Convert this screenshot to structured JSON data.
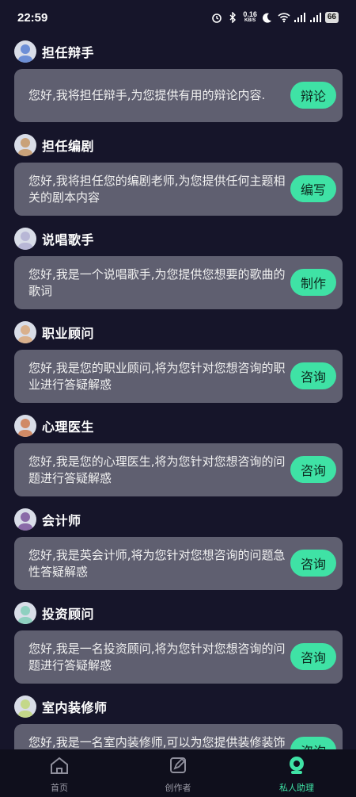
{
  "status_bar": {
    "time": "22:59",
    "network_speed": "0.16",
    "speed_unit": "KB/S",
    "battery": "66"
  },
  "assistants": [
    {
      "name": "担任辩手",
      "description": "您好,我将担任辩手,为您提供有用的辩论内容.",
      "action": "辩论",
      "avatar_color": "#6d8fd6"
    },
    {
      "name": "担任编剧",
      "description": "您好,我将担任您的编剧老师,为您提供任何主题相关的剧本内容",
      "action": "编写",
      "avatar_color": "#c9a27a"
    },
    {
      "name": "说唱歌手",
      "description": "您好,我是一个说唱歌手,为您提供您想要的歌曲的歌词",
      "action": "制作",
      "avatar_color": "#b8b7d6"
    },
    {
      "name": "职业顾问",
      "description": "您好,我是您的职业顾问,将为您针对您想咨询的职业进行答疑解惑",
      "action": "咨询",
      "avatar_color": "#d9b08c"
    },
    {
      "name": "心理医生",
      "description": "您好,我是您的心理医生,将为您针对您想咨询的问题进行答疑解惑",
      "action": "咨询",
      "avatar_color": "#d08a66"
    },
    {
      "name": "会计师",
      "description": "您好,我是英会计师,将为您针对您想咨询的问题急性答疑解惑",
      "action": "咨询",
      "avatar_color": "#8a6aa8"
    },
    {
      "name": "投资顾问",
      "description": "您好,我是一名投资顾问,将为您针对您想咨询的问题进行答疑解惑",
      "action": "咨询",
      "avatar_color": "#8fd0c0"
    },
    {
      "name": "室内装修师",
      "description": "您好,我是一名室内装修师,可以为您提供装修装饰相关的建议.",
      "action": "咨询",
      "avatar_color": "#c4d88a"
    }
  ],
  "nav": [
    {
      "label": "首页",
      "icon": "home-icon",
      "active": false
    },
    {
      "label": "创作者",
      "icon": "pencil-icon",
      "active": false
    },
    {
      "label": "私人助理",
      "icon": "assistant-icon",
      "active": true
    }
  ],
  "colors": {
    "background": "#16152a",
    "card": "#5f5f70",
    "accent": "#3fe2a5",
    "nav_bg": "#0f0f1c"
  }
}
